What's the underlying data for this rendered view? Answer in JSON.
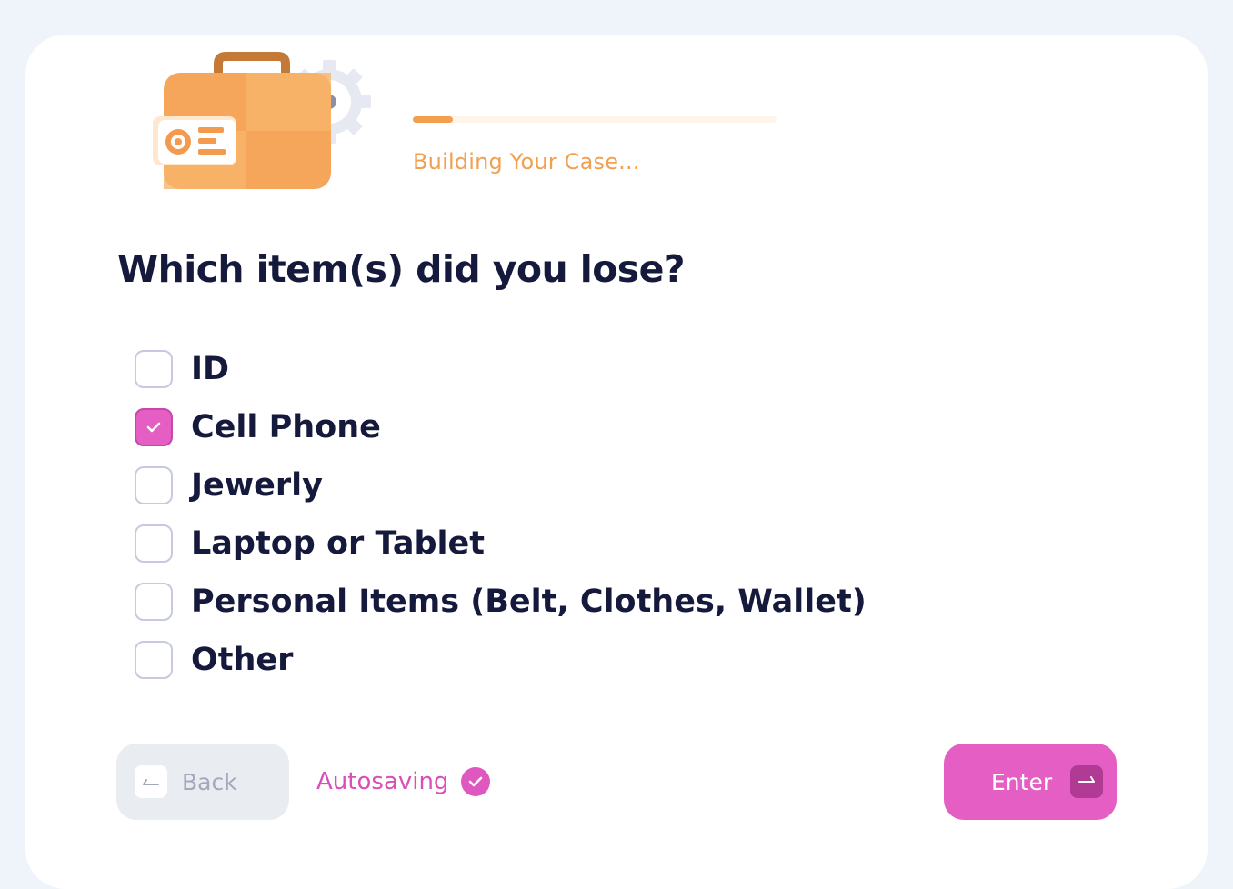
{
  "progress": {
    "value_percent": 11,
    "label": "Building Your Case...",
    "color": "#f2a04e"
  },
  "illustration": {
    "icon": "briefcase-with-id-card-and-gear-icon"
  },
  "question": "Which item(s) did you lose?",
  "options": [
    {
      "label": "ID",
      "checked": false
    },
    {
      "label": "Cell Phone",
      "checked": true
    },
    {
      "label": "Jewerly",
      "checked": false
    },
    {
      "label": "Laptop or Tablet",
      "checked": false
    },
    {
      "label": "Personal Items (Belt, Clothes, Wallet)",
      "checked": false
    },
    {
      "label": "Other",
      "checked": false
    }
  ],
  "footer": {
    "back_label": "Back",
    "back_icon": "arrow-left-icon",
    "autosave_label": "Autosaving",
    "autosave_icon": "check-circle-icon",
    "enter_label": "Enter",
    "enter_icon": "arrow-right-icon"
  },
  "colors": {
    "accent": "#e45ec4",
    "heading": "#151a3d",
    "progress": "#f2a04e"
  }
}
